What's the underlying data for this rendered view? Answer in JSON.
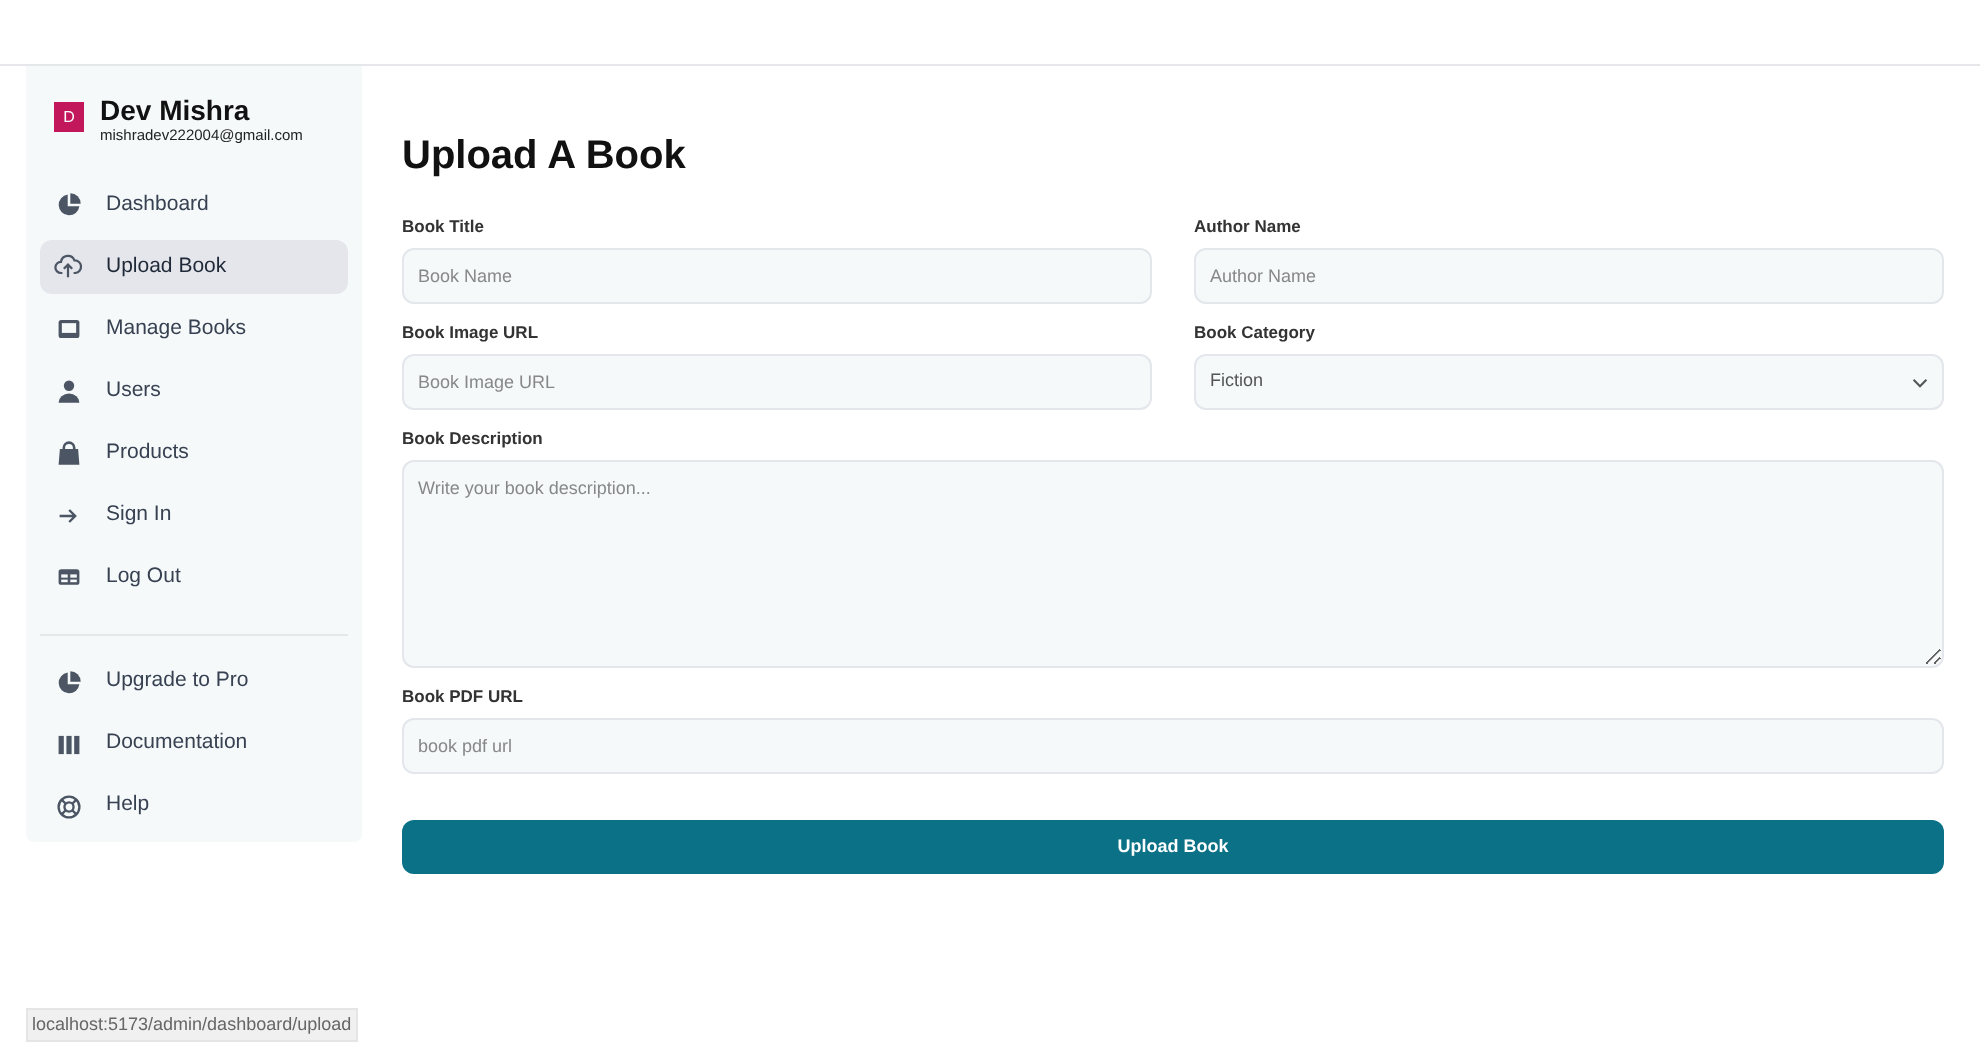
{
  "user": {
    "initial": "D",
    "name": "Dev Mishra",
    "email": "mishradev222004@gmail.com"
  },
  "nav": [
    {
      "label": "Dashboard",
      "selected": false
    },
    {
      "label": "Upload Book",
      "selected": true
    },
    {
      "label": "Manage Books",
      "selected": false
    },
    {
      "label": "Users",
      "selected": false
    },
    {
      "label": "Products",
      "selected": false
    },
    {
      "label": "Sign In",
      "selected": false
    },
    {
      "label": "Log Out",
      "selected": false
    }
  ],
  "nav_secondary": [
    {
      "label": "Upgrade to Pro",
      "selected": false
    },
    {
      "label": "Documentation",
      "selected": false
    },
    {
      "label": "Help",
      "selected": false
    }
  ],
  "heading": "Upload A Book",
  "fields": [
    {
      "kind": "input",
      "label": "Book Title",
      "placeholder": "Book Name"
    },
    {
      "kind": "input",
      "label": "Author Name",
      "placeholder": "Author Name"
    },
    {
      "kind": "input",
      "label": "Book Image URL",
      "placeholder": "Book Image URL"
    },
    {
      "kind": "select",
      "label": "Book Category",
      "value": "Fiction"
    },
    {
      "kind": "textarea",
      "label": "Book Description",
      "placeholder": "Write your book description..."
    },
    {
      "kind": "input",
      "label": "Book PDF URL",
      "placeholder": "book pdf url"
    }
  ],
  "submit": "Upload Book",
  "status_bar": "localhost:5173/admin/dashboard/upload"
}
